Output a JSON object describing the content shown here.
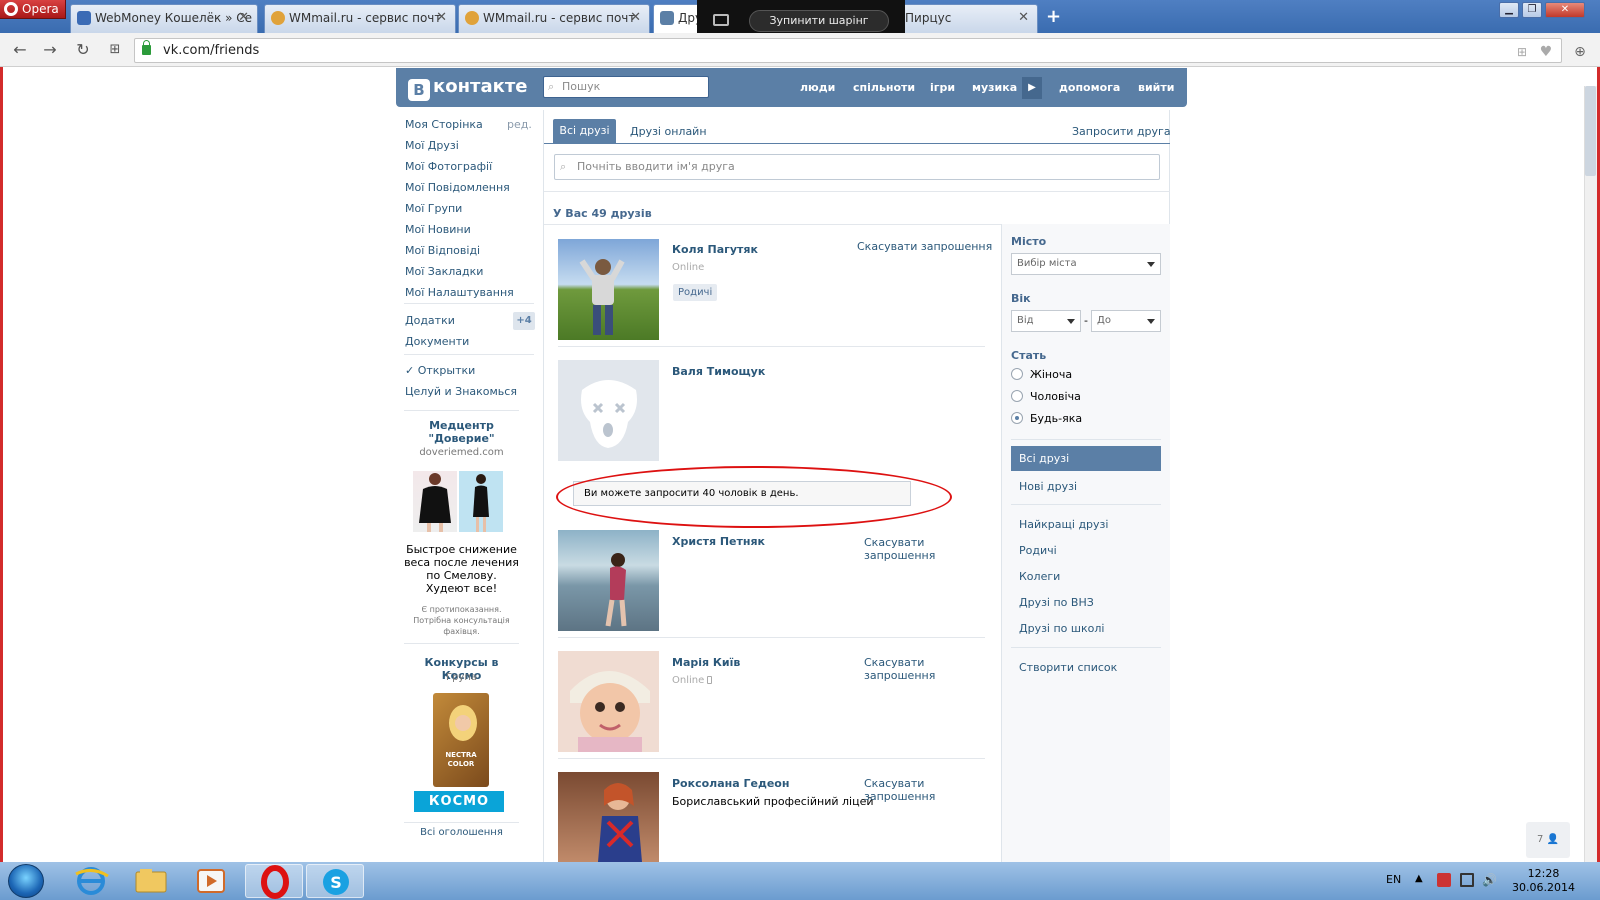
{
  "browser": {
    "menu_label": "Opera",
    "tabs": [
      {
        "title": "WebMoney Кошелёк » Се",
        "fav_color": "#3b6bb5"
      },
      {
        "title": "WMmail.ru - сервис почт",
        "fav_color": "#e0a23a"
      },
      {
        "title": "WMmail.ru - сервис почт",
        "fav_color": "#e0a23a"
      },
      {
        "title": "Дру",
        "fav_color": "#5b7fa6"
      },
      {
        "title": "Пирцус",
        "fav_color": "#5b7fa6"
      }
    ],
    "new_tab_symbol": "+",
    "share_stop_label": "Зупинити шарінг",
    "url": "vk.com/friends"
  },
  "vk": {
    "logo": "контакте",
    "logo_letter": "В",
    "search_placeholder": "Пошук",
    "nav": [
      "люди",
      "спільноти",
      "ігри",
      "музика",
      "допомога",
      "вийти"
    ],
    "left_menu": [
      "Моя Сторінка",
      "Мої Друзі",
      "Мої Фотографії",
      "Мої Повідомлення",
      "Мої Групи",
      "Мої Новини",
      "Мої Відповіді",
      "Мої Закладки",
      "Мої Налаштування"
    ],
    "edit_label": "ред.",
    "apps_label": "Додатки",
    "apps_badge": "+4",
    "docs_label": "Документи",
    "extra_items": [
      "✓ Открытки",
      "Целуй и Знакомься"
    ],
    "ad1": {
      "title": "Медцентр \"Доверие\"",
      "domain": "doveriemed.com",
      "text": "Быстрое снижение веса после лечения по Смелову. Худеют все!",
      "note": "Є протипоказання. Потрібна консультація фахівця."
    },
    "ad2": {
      "title": "Конкурсы в Космо",
      "sub": "Група",
      "brand": "КОСМО",
      "product": "NECTRA COLOR"
    },
    "all_ads": "Всі оголошення",
    "tabs": {
      "all": "Всі друзі",
      "online": "Друзі онлайн",
      "invite": "Запросити друга"
    },
    "friend_search_placeholder": "Почніть вводити ім'я друга",
    "friend_count": "У Вас 49 друзів",
    "friends": [
      {
        "name": "Коля Пагутяк",
        "status": "Online",
        "tag": "Родичі",
        "action": "Скасувати запрошення"
      },
      {
        "name": "Валя Тимощук",
        "status": "",
        "action": ""
      },
      {
        "name": "Христя Петняк",
        "status": "",
        "action": "Скасувати запрошення"
      },
      {
        "name": "Марія Київ",
        "status": "Online",
        "action": "Скасувати запрошення"
      },
      {
        "name": "Роксолана Гедеон",
        "status": "",
        "subtitle": "Бориславський професійний ліцей",
        "action": "Скасувати запрошення"
      }
    ],
    "invite_limit_msg": "Ви можете запросити 40 чоловік в день.",
    "filter": {
      "city_label": "Місто",
      "city_select": "Вибір міста",
      "age_label": "Вік",
      "age_from": "Від",
      "age_dash": "-",
      "age_to": "До",
      "sex_label": "Стать",
      "sex_options": [
        "Жіноча",
        "Чоловіча",
        "Будь-яка"
      ],
      "sex_selected": 2,
      "lists_active": "Всі друзі",
      "lists": [
        "Нові друзі",
        "Найкращі друзі",
        "Родичі",
        "Колеги",
        "Друзі по ВНЗ",
        "Друзі по школі",
        "Створити список"
      ]
    },
    "corner_badge": "7"
  },
  "taskbar": {
    "lang": "EN",
    "time": "12:28",
    "date": "30.06.2014"
  }
}
